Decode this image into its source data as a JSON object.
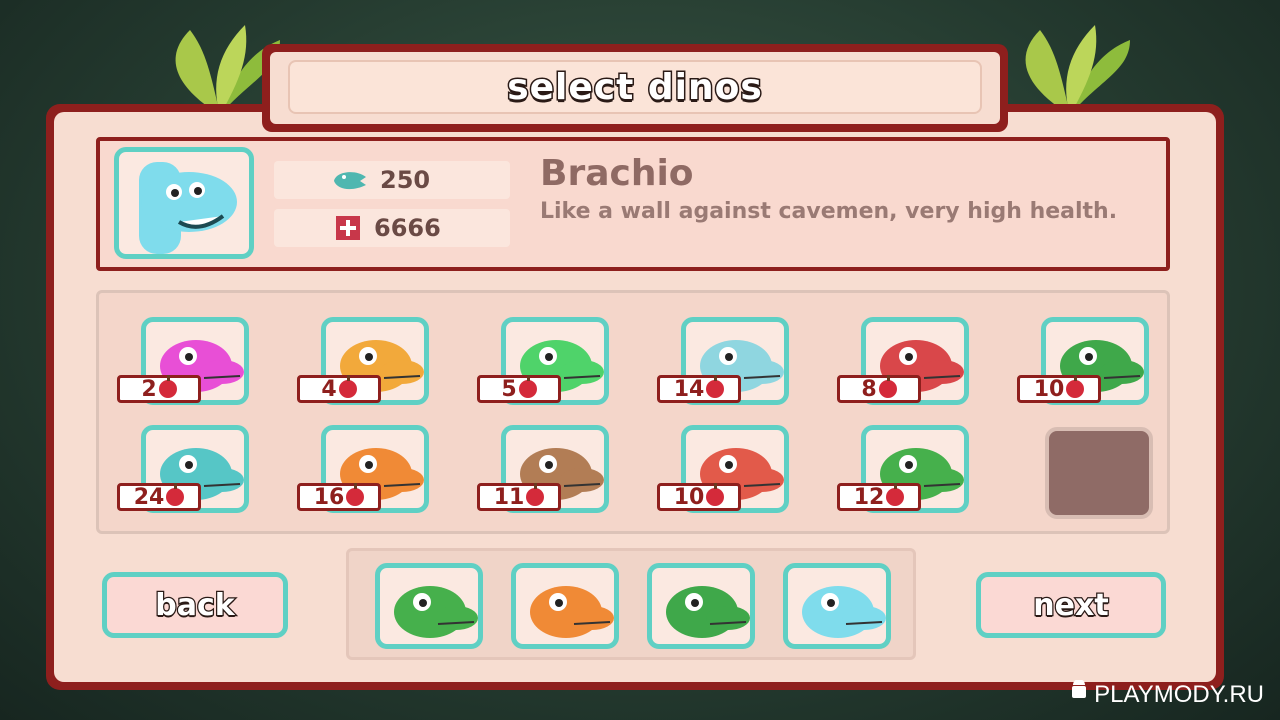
{
  "title": "select dinos",
  "selected": {
    "name": "Brachio",
    "description": "Like a wall against cavemen, very high health.",
    "attack": "250",
    "health": "6666",
    "attack_icon": "dino-head-icon",
    "health_icon": "health-cross-icon"
  },
  "dinos": [
    {
      "id": "spiky",
      "cost": "2",
      "color": "#e84fd6"
    },
    {
      "id": "ptero",
      "cost": "4",
      "color": "#f2a93b"
    },
    {
      "id": "eyeball",
      "cost": "5",
      "color": "#4fd36a"
    },
    {
      "id": "trike",
      "cost": "14",
      "color": "#8fd6e0"
    },
    {
      "id": "red-blob",
      "cost": "8",
      "color": "#d9474a"
    },
    {
      "id": "green-croc",
      "cost": "10",
      "color": "#3fa84a"
    },
    {
      "id": "teal-brachio",
      "cost": "24",
      "color": "#56c6c6"
    },
    {
      "id": "orange-spiky",
      "cost": "16",
      "color": "#f08a36"
    },
    {
      "id": "brown-trex",
      "cost": "11",
      "color": "#b27d55"
    },
    {
      "id": "red-stego",
      "cost": "10",
      "color": "#e25a4a"
    },
    {
      "id": "green-croc-2",
      "cost": "12",
      "color": "#46b04c"
    }
  ],
  "team": [
    {
      "id": "green-croc-pink",
      "color": "#46b04c"
    },
    {
      "id": "orange-trex",
      "color": "#f08a36"
    },
    {
      "id": "green-croc-team",
      "color": "#3fa84a"
    },
    {
      "id": "blue-brachio",
      "color": "#7fdcec"
    }
  ],
  "buttons": {
    "back": "back",
    "next": "next"
  },
  "watermark": "PLAYMODY.RU"
}
